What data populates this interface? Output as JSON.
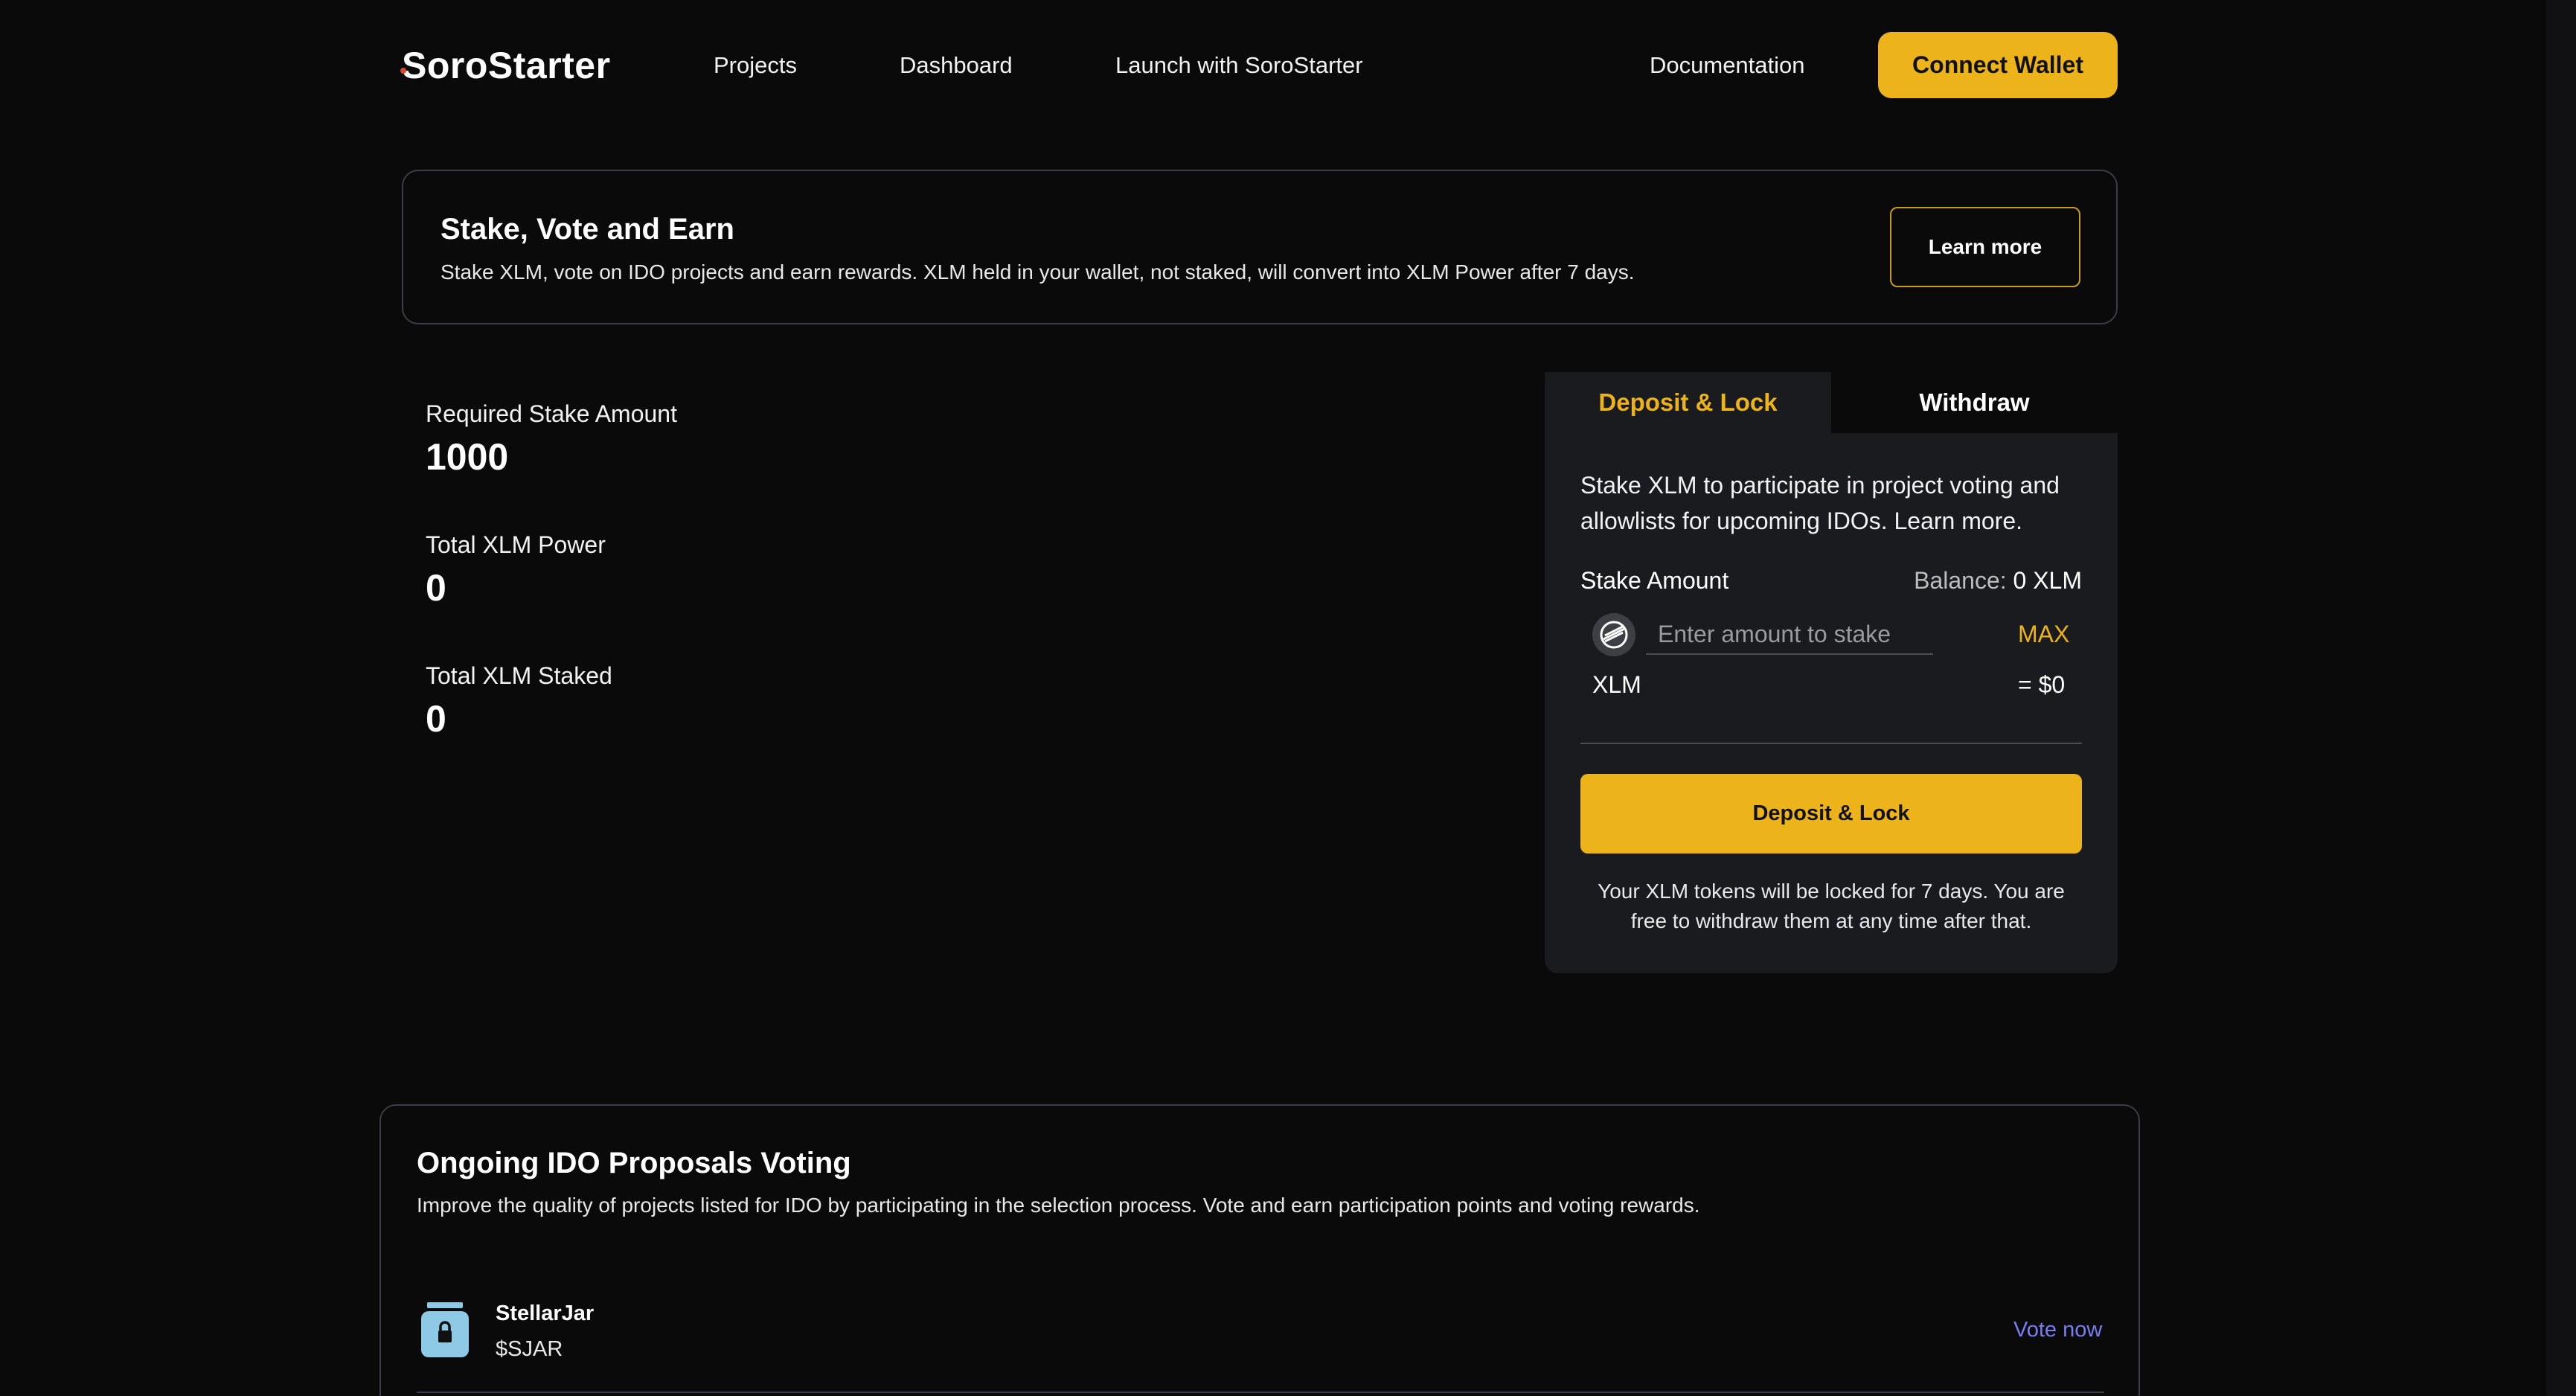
{
  "nav": {
    "logo": "SoroStarter",
    "links": [
      "Projects",
      "Dashboard",
      "Launch with SoroStarter",
      "Documentation"
    ],
    "connect_label": "Connect Wallet"
  },
  "banner": {
    "title": "Stake, Vote and Earn",
    "description": "Stake XLM, vote on IDO projects and earn rewards. XLM held in your wallet, not staked, will convert into XLM Power after 7 days.",
    "learn_more_label": "Learn more"
  },
  "stats": [
    {
      "label": "Required Stake Amount",
      "value": "1000"
    },
    {
      "label": "Total XLM Power",
      "value": "0"
    },
    {
      "label": "Total XLM Staked",
      "value": "0"
    }
  ],
  "stake_panel": {
    "tabs": [
      "Deposit & Lock",
      "Withdraw"
    ],
    "active_tab": "Deposit & Lock",
    "description": "Stake XLM to participate in project voting and allowlists for upcoming IDOs. Learn more.",
    "stake_amount_label": "Stake Amount",
    "balance_label": "Balance:",
    "balance_value": "0 XLM",
    "input_placeholder": "Enter amount to stake",
    "max_label": "MAX",
    "unit": "XLM",
    "usd_value": "= $0",
    "deposit_button": "Deposit & Lock",
    "lock_note": "Your XLM tokens will be locked for 7 days. You are free to withdraw them at any time after that.",
    "token_icon": "stellar-icon"
  },
  "proposals": {
    "title": "Ongoing IDO Proposals Voting",
    "description": "Improve the quality of projects listed for IDO by participating in the selection process. Vote and earn participation points and voting rewards.",
    "items": [
      {
        "name": "StellarJar",
        "ticker": "$SJAR",
        "action": "Vote now",
        "icon": "jar-lock-icon"
      }
    ]
  },
  "colors": {
    "accent": "#ecb31a",
    "background": "#0a0a0b",
    "panel": "#1a1b1f",
    "link": "#7a7df0"
  }
}
